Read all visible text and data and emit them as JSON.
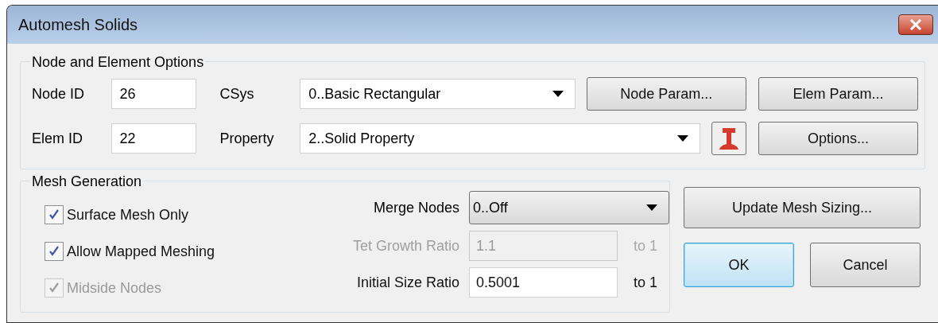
{
  "window": {
    "title": "Automesh Solids"
  },
  "node_element_options": {
    "title": "Node and Element Options",
    "rows": [
      {
        "id_label": "Node ID",
        "id_value": "26",
        "select_label": "CSys",
        "select_value": "0..Basic Rectangular",
        "kind": "plain",
        "buttons": [
          "Node Param...",
          "Elem Param..."
        ]
      },
      {
        "id_label": "Elem ID",
        "id_value": "22",
        "select_label": "Property",
        "select_value": "2..Solid Property",
        "kind": "with_icon",
        "buttons": [
          "Options..."
        ]
      }
    ]
  },
  "mesh_generation": {
    "title": "Mesh Generation",
    "checkboxes": [
      {
        "label": "Surface Mesh Only",
        "checked": true,
        "disabled": false
      },
      {
        "label": "Allow Mapped Meshing",
        "checked": true,
        "disabled": false
      },
      {
        "label": "Midside Nodes",
        "checked": true,
        "disabled": true
      }
    ],
    "merge_nodes": {
      "label": "Merge Nodes",
      "value": "0..Off"
    },
    "ratios": [
      {
        "label": "Tet Growth Ratio",
        "value": "1.1",
        "suffix": "to 1",
        "disabled": true
      },
      {
        "label": "Initial Size Ratio",
        "value": "0.5001",
        "suffix": "to 1",
        "disabled": false
      }
    ]
  },
  "buttons": [
    {
      "label": "Update Mesh Sizing...",
      "default": false
    },
    {
      "label": "OK",
      "default": true
    },
    {
      "label": "Cancel",
      "default": false
    }
  ]
}
